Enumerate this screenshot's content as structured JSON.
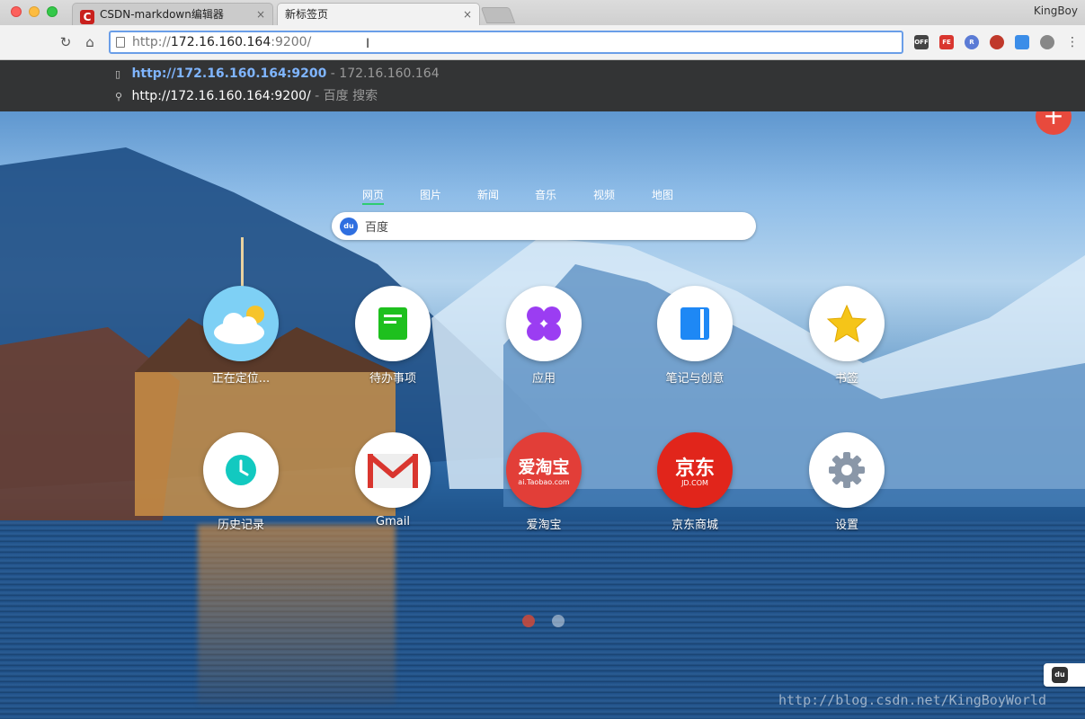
{
  "browser": {
    "tabs": [
      {
        "title": "CSDN-markdown编辑器",
        "favicon": "csdn-icon",
        "active": false
      },
      {
        "title": "新标签页",
        "active": true
      }
    ],
    "close_glyph": "×",
    "profile": "KingBoy",
    "address": {
      "prefix": "http://",
      "host": "172.16.160.164",
      "rest": ":9200/"
    }
  },
  "suggestions": [
    {
      "icon": "page-icon",
      "highlight": "http://172.16.160.164:9200",
      "meta": " - 172.16.160.164"
    },
    {
      "icon": "search-icon",
      "text": "http://172.16.160.164:9200/",
      "meta": " - 百度 搜索"
    }
  ],
  "search": {
    "tabs": [
      "网页",
      "图片",
      "新闻",
      "音乐",
      "视频",
      "地图"
    ],
    "active_tab": "网页",
    "engine_label": "百度"
  },
  "tiles": [
    {
      "label": "正在定位...",
      "icon": "weather-icon"
    },
    {
      "label": "待办事项",
      "icon": "todo-icon"
    },
    {
      "label": "应用",
      "icon": "apps-icon"
    },
    {
      "label": "笔记与创意",
      "icon": "notes-icon"
    },
    {
      "label": "书签",
      "icon": "star-icon"
    },
    {
      "label": "历史记录",
      "icon": "clock-icon"
    },
    {
      "label": "Gmail",
      "icon": "gmail-icon"
    },
    {
      "label": "爱淘宝",
      "icon": "taobao-icon",
      "logo_text": "爱淘宝",
      "logo_sub": "ai.Taobao.com"
    },
    {
      "label": "京东商城",
      "icon": "jd-icon",
      "logo_text": "京东",
      "logo_sub": "JD.COM"
    },
    {
      "label": "设置",
      "icon": "gear-icon"
    }
  ],
  "colors": {
    "accent_green": "#2ecc71",
    "fab_red": "#e84a3d",
    "taobao_red": "#e23e38",
    "jd_red": "#e1251b"
  },
  "watermark": "http://blog.csdn.net/KingBoyWorld"
}
